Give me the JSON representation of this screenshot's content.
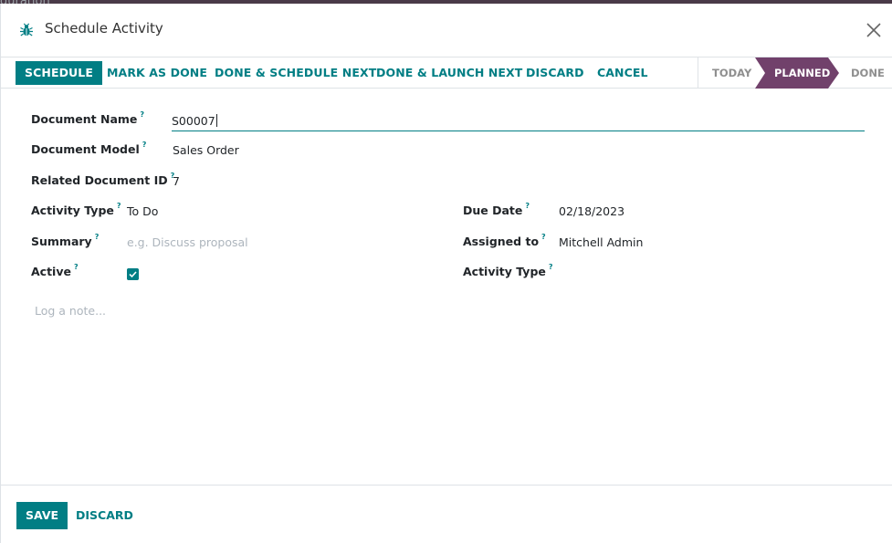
{
  "background": {
    "sliver_text": "guration"
  },
  "dialog": {
    "title": "Schedule Activity",
    "title_icon": "bug-icon",
    "close_icon": "close-icon"
  },
  "statusbar": {
    "buttons": {
      "schedule": "SCHEDULE",
      "mark_as_done": "MARK AS DONE",
      "done_schedule_next": "DONE & SCHEDULE NEXT",
      "done_launch_next": "DONE & LAUNCH NEXT",
      "discard": "DISCARD",
      "cancel": "CANCEL"
    },
    "stages": [
      "TODAY",
      "PLANNED",
      "DONE"
    ],
    "active_stage": "PLANNED"
  },
  "form": {
    "document_name": {
      "label": "Document Name",
      "help": "?",
      "value": "S00007"
    },
    "document_model": {
      "label": "Document Model",
      "help": "?",
      "value": "Sales Order"
    },
    "related_document_id": {
      "label": "Related Document ID",
      "help": "?",
      "value": "7"
    },
    "activity_type": {
      "label": "Activity Type",
      "help": "?",
      "value": "To Do"
    },
    "summary": {
      "label": "Summary",
      "help": "?",
      "placeholder": "e.g. Discuss proposal"
    },
    "active": {
      "label": "Active",
      "help": "?",
      "checked": true
    },
    "due_date": {
      "label": "Due Date",
      "help": "?",
      "value": "02/18/2023"
    },
    "assigned_to": {
      "label": "Assigned to",
      "help": "?",
      "value": "Mitchell Admin"
    },
    "activity_type_2": {
      "label": "Activity Type",
      "help": "?",
      "value": ""
    },
    "note": {
      "placeholder": "Log a note..."
    }
  },
  "footer": {
    "save": "SAVE",
    "discard": "DISCARD"
  },
  "colors": {
    "primary": "#017e84",
    "stage_active": "#71416b",
    "topbar": "#4a3a48"
  }
}
